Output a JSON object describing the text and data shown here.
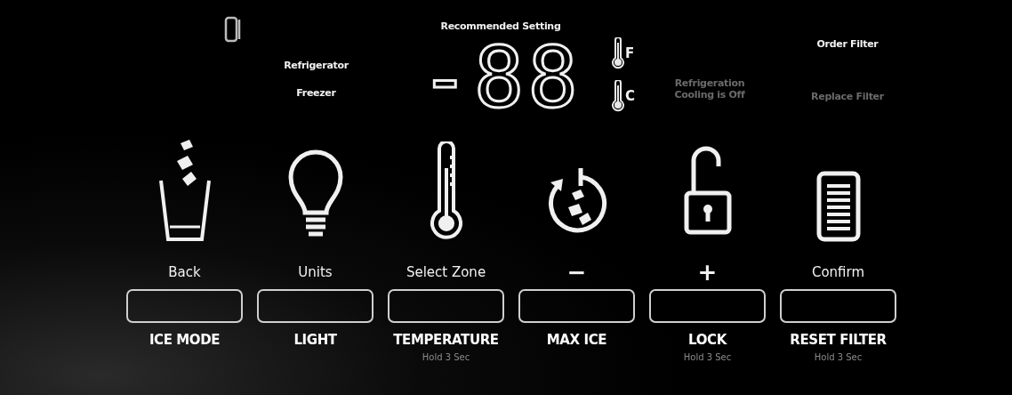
{
  "zones": [
    {
      "label": "Refrigerator",
      "lit": true
    },
    {
      "label": "Freezer",
      "lit": true
    }
  ],
  "display": {
    "caption": "Recommended Setting",
    "reading": "-88"
  },
  "units": [
    {
      "label": "F",
      "lit": true
    },
    {
      "label": "C",
      "lit": true
    }
  ],
  "cooling_notice": {
    "text": "Refrigeration Cooling is Off",
    "lit": false
  },
  "filter_status": [
    {
      "label": "Order Filter",
      "lit": true
    },
    {
      "label": "Replace Filter",
      "lit": false
    }
  ],
  "controls": [
    {
      "kind": "ice-mode",
      "alt": "Back",
      "label": "ICE MODE"
    },
    {
      "kind": "light",
      "alt": "Units",
      "label": "LIGHT"
    },
    {
      "kind": "temperature",
      "alt": "Select Zone",
      "label": "TEMPERATURE",
      "hint": "Hold 3 Sec"
    },
    {
      "kind": "max-ice",
      "alt": "−",
      "label": "MAX ICE"
    },
    {
      "kind": "lock",
      "alt": "+",
      "label": "LOCK",
      "hint": "Hold 3 Sec"
    },
    {
      "kind": "filter",
      "alt": "Confirm",
      "label": "RESET FILTER",
      "hint": "Hold 3 Sec"
    }
  ]
}
